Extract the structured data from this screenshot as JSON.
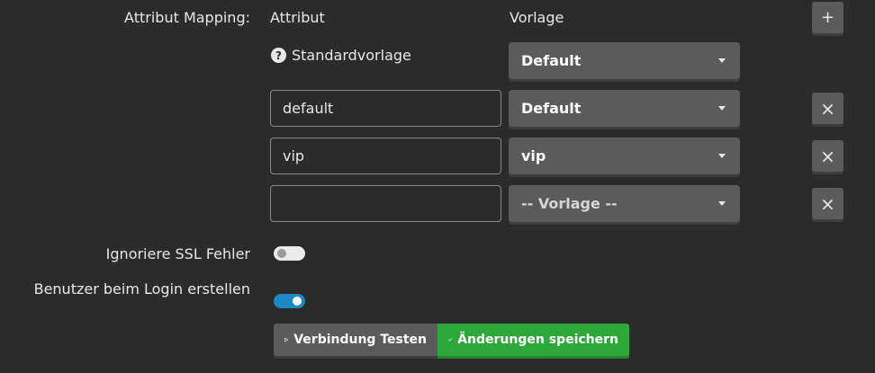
{
  "mapping": {
    "label": "Attribut Mapping:",
    "col_attribute": "Attribut",
    "col_template": "Vorlage",
    "add_symbol": "+",
    "default_row": {
      "help_symbol": "?",
      "label": "Standardvorlage",
      "template": "Default"
    },
    "rows": [
      {
        "attribute": "default",
        "template": "Default"
      },
      {
        "attribute": "vip",
        "template": "vip"
      },
      {
        "attribute": "",
        "template": "-- Vorlage --"
      }
    ],
    "remove_symbol": "×"
  },
  "options": {
    "ignore_ssl": {
      "label": "Ignoriere SSL Fehler",
      "enabled": false
    },
    "create_on_login": {
      "label": "Benutzer beim Login erstellen",
      "enabled": true
    }
  },
  "actions": {
    "test_label": "Verbindung Testen",
    "save_label": "Änderungen speichern"
  },
  "colors": {
    "background": "#2b2b2b",
    "control": "#5b5b5b",
    "toggle_on": "#1e88c7",
    "save": "#2fa83b"
  }
}
